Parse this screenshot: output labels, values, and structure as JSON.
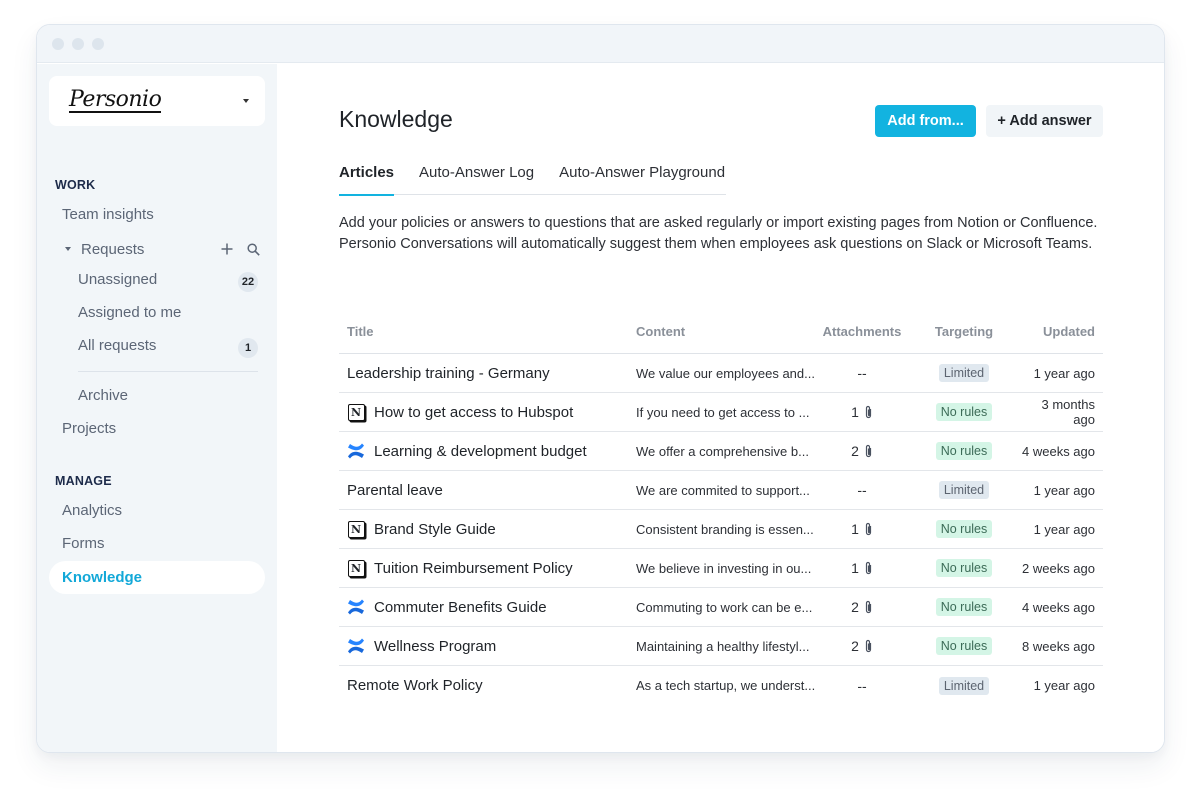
{
  "window": {
    "controls": [
      "close",
      "minimize",
      "maximize"
    ]
  },
  "sidebar": {
    "brand": {
      "logo_text": "Personio",
      "dropdown_icon": "caret-down-icon"
    },
    "sections": [
      {
        "label": "WORK"
      },
      {
        "label": "MANAGE"
      }
    ],
    "work": {
      "team_insights": "Team insights",
      "requests": {
        "label": "Requests",
        "add_icon": "plus-icon",
        "search_icon": "search-icon",
        "items": [
          {
            "label": "Unassigned",
            "count": "22"
          },
          {
            "label": "Assigned to me",
            "count": null
          },
          {
            "label": "All requests",
            "count": "1"
          }
        ]
      },
      "archive": "Archive",
      "projects": "Projects"
    },
    "manage": {
      "items": [
        {
          "label": "Analytics"
        },
        {
          "label": "Forms"
        },
        {
          "label": "Knowledge",
          "active": true
        }
      ]
    }
  },
  "main": {
    "title": "Knowledge",
    "buttons": {
      "add_from": "Add from...",
      "add_answer": "+ Add answer"
    },
    "tabs": [
      {
        "label": "Articles",
        "active": true
      },
      {
        "label": "Auto-Answer Log",
        "active": false
      },
      {
        "label": "Auto-Answer Playground",
        "active": false
      }
    ],
    "description": "Add your policies or answers to questions that are asked regularly or import existing pages from Notion or Confluence. Personio Conversations will automatically suggest them when employees ask questions on Slack or Microsoft Teams.",
    "table": {
      "columns": [
        "Title",
        "Content",
        "Attachments",
        "Targeting",
        "Updated"
      ],
      "rows": [
        {
          "source": "",
          "title": "Leadership training - Germany",
          "content": "We value our employees and...",
          "attachments": "--",
          "targeting": "Limited",
          "updated": "1 year ago"
        },
        {
          "source": "notion",
          "title": "How to get access to Hubspot",
          "content": "If you need to get access to ...",
          "attachments": "1",
          "targeting": "No rules",
          "updated": "3 months ago"
        },
        {
          "source": "confluence",
          "title": "Learning & development budget",
          "content": "We offer a comprehensive b...",
          "attachments": "2",
          "targeting": "No rules",
          "updated": "4 weeks ago"
        },
        {
          "source": "",
          "title": "Parental leave",
          "content": "We are commited to support...",
          "attachments": "--",
          "targeting": "Limited",
          "updated": "1 year ago"
        },
        {
          "source": "notion",
          "title": "Brand Style Guide",
          "content": "Consistent branding is essen...",
          "attachments": "1",
          "targeting": "No rules",
          "updated": "1 year ago"
        },
        {
          "source": "notion",
          "title": "Tuition Reimbursement Policy",
          "content": "We believe in investing in ou...",
          "attachments": "1",
          "targeting": "No rules",
          "updated": "2 weeks ago"
        },
        {
          "source": "confluence",
          "title": "Commuter Benefits Guide",
          "content": "Commuting to work can be e...",
          "attachments": "2",
          "targeting": "No rules",
          "updated": "4 weeks ago"
        },
        {
          "source": "confluence",
          "title": "Wellness Program",
          "content": "Maintaining a healthy lifestyl...",
          "attachments": "2",
          "targeting": "No rules",
          "updated": "8 weeks ago"
        },
        {
          "source": "",
          "title": "Remote Work Policy",
          "content": "As a tech startup, we underst...",
          "attachments": "--",
          "targeting": "Limited",
          "updated": "1 year ago"
        }
      ]
    }
  },
  "colors": {
    "accent": "#12b3e0",
    "active_nav": "#12a8d8",
    "limited_bg": "#e0e8ef",
    "no_rules_bg": "#d4f5e6",
    "confluence_blue": "#1868db",
    "sidebar_bg": "#f2f6f9"
  }
}
